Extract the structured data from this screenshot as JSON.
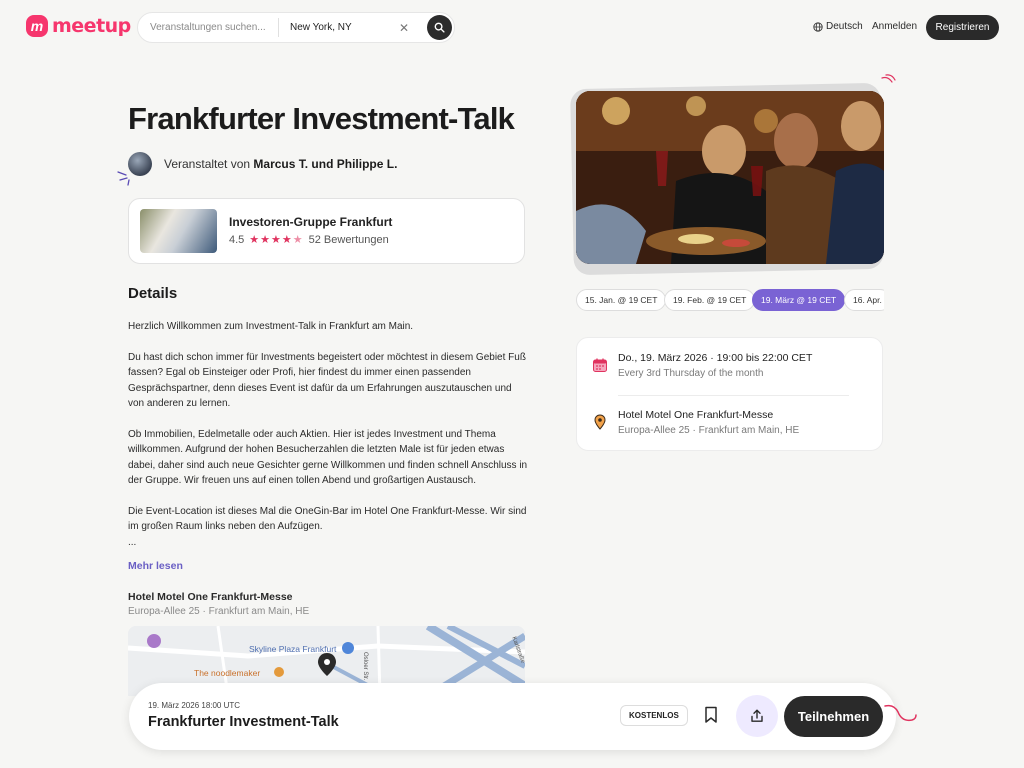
{
  "header": {
    "logo_text": "meetup",
    "search_placeholder": "Veranstaltungen suchen...",
    "location_value": "New York, NY",
    "language": "Deutsch",
    "login": "Anmelden",
    "register": "Registrieren"
  },
  "event": {
    "title": "Frankfurter Investment-Talk",
    "hosted_by_prefix": "Veranstaltet von",
    "hosts": "Marcus T. und Philippe L."
  },
  "group": {
    "name": "Investoren-Gruppe Frankfurt",
    "rating": "4.5",
    "rating_value": 4.5,
    "reviews": "52 Bewertungen"
  },
  "details": {
    "heading": "Details",
    "paragraphs": [
      "Herzlich Willkommen zum Investment-Talk in Frankfurt am Main.",
      "Du hast dich schon immer für Investments begeistert oder möchtest in diesem Gebiet Fuß fassen? Egal ob Einsteiger oder Profi, hier findest du immer einen passenden Gesprächspartner, denn dieses Event ist dafür da um Erfahrungen auszutauschen und von anderen zu lernen.",
      "Ob Immobilien, Edelmetalle oder auch Aktien. Hier ist jedes Investment und Thema willkommen. Aufgrund der hohen Besucherzahlen die letzten Male ist für jeden etwas dabei, daher sind auch neue Gesichter gerne Willkommen und finden schnell Anschluss in der Gruppe. Wir freuen uns auf einen tollen Abend und großartigen Austausch.",
      "Die Event-Location ist dieses Mal die OneGin-Bar im Hotel One Frankfurt-Messe. Wir sind im großen Raum links neben den Aufzügen.",
      "..."
    ],
    "read_more": "Mehr lesen"
  },
  "venue": {
    "name": "Hotel Motel One Frankfurt-Messe",
    "address": "Europa-Allee 25 · Frankfurt am Main, HE"
  },
  "map": {
    "labels": {
      "plaza": "Skyline Plaza Frankfurt",
      "noodle": "The noodlemaker",
      "street1": "Osloer Str.",
      "street2": "Karlstraße"
    }
  },
  "dates": [
    {
      "label": "15. Jan. @ 19 CET",
      "active": false
    },
    {
      "label": "19. Feb. @ 19 CET",
      "active": false
    },
    {
      "label": "19. März @ 19 CET",
      "active": true
    },
    {
      "label": "16. Apr.",
      "active": false
    }
  ],
  "info": {
    "date_line": "Do., 19. März 2026 · 19:00 bis 22:00 CET",
    "recurrence": "Every 3rd Thursday of the month",
    "venue_name": "Hotel Motel One Frankfurt-Messe",
    "venue_address": "Europa-Allee 25 · Frankfurt am Main, HE"
  },
  "bottom_bar": {
    "date": "19. März 2026 18:00 UTC",
    "title": "Frankfurter Investment-Talk",
    "price": "KOSTENLOS",
    "attend": "Teilnehmen"
  },
  "colors": {
    "brand": "#f6366d",
    "accent": "#7a63d4",
    "dark": "#2a2a2a",
    "star": "#e0335f"
  }
}
